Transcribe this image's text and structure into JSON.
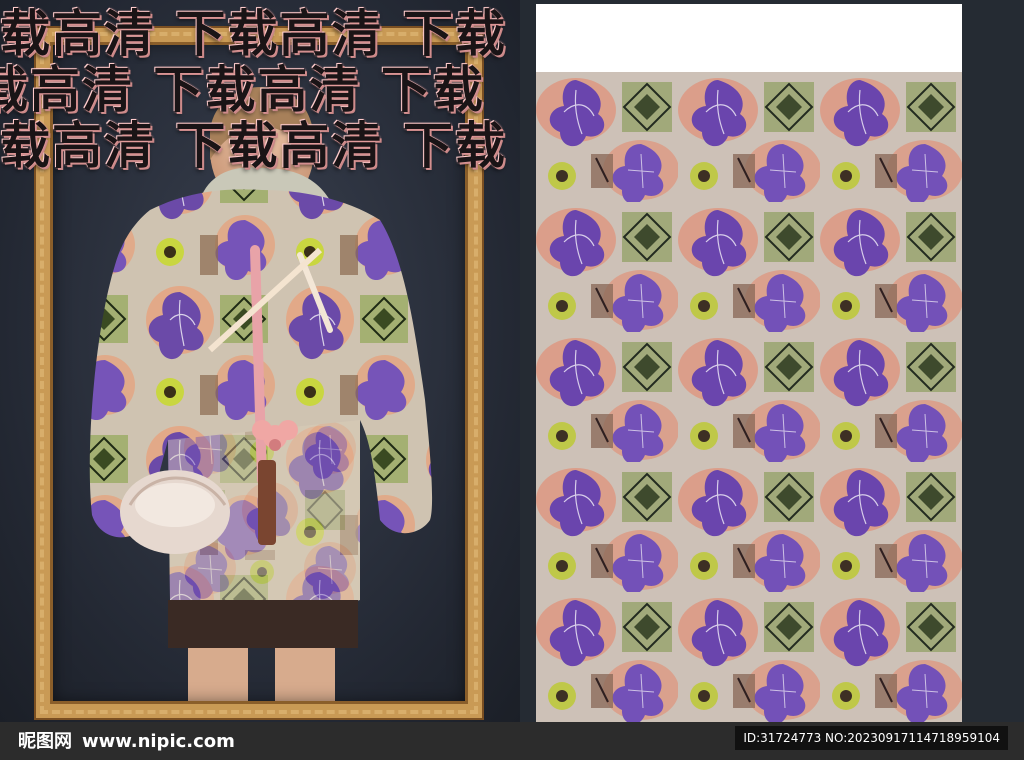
{
  "watermark": {
    "row1": "载高清 下载高清 下载",
    "row2": "载高清 下载高清 下载",
    "row3": "载高清 下载高清 下载"
  },
  "footer": {
    "brand_cn": "昵图网",
    "brand_url": "www.nipic.com",
    "id_text": "ID:31724773 NO:20230917114718959104"
  },
  "colors": {
    "purple": "#6b4aa8",
    "peach": "#e8a07a",
    "green": "#9aa86a",
    "frame_gold": "#c99a55"
  }
}
